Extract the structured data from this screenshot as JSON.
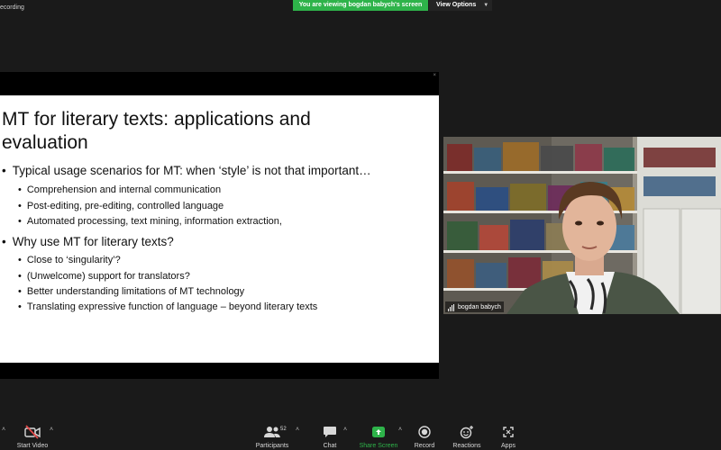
{
  "app": {
    "recording_label": "ecording",
    "banner": "You are viewing bogdan babych's screen",
    "view_options": "View Options"
  },
  "slide": {
    "title_line1": "MT for literary texts: applications and",
    "title_line2": "evaluation",
    "bullet1": "Typical usage scenarios for MT: when ‘style’ is not that important…",
    "sub1": [
      "Comprehension and internal communication",
      "Post-editing, pre-editing, controlled language",
      "Automated processing, text mining, information extraction,"
    ],
    "bullet2": "Why use MT for literary texts?",
    "sub2": [
      "Close to ‘singularity’?",
      "(Unwelcome) support for translators?",
      "Better understanding limitations of MT technology",
      "Translating expressive function of language – beyond literary texts"
    ]
  },
  "video": {
    "name": "bogdan babych"
  },
  "toolbar": {
    "start_video": "Start Video",
    "participants": "Participants",
    "participants_count": "52",
    "chat": "Chat",
    "share_screen": "Share Screen",
    "record": "Record",
    "reactions": "Reactions",
    "apps": "Apps"
  },
  "colors": {
    "banner": "#2eb34a",
    "share_icon": "#2eb34a",
    "background": "#1a1a1a"
  },
  "icons": [
    "video-off-icon",
    "participants-icon",
    "chat-icon",
    "share-screen-icon",
    "record-icon",
    "reactions-icon",
    "apps-icon",
    "chevron-up-icon",
    "chevron-down-icon",
    "signal-icon",
    "close-icon"
  ]
}
